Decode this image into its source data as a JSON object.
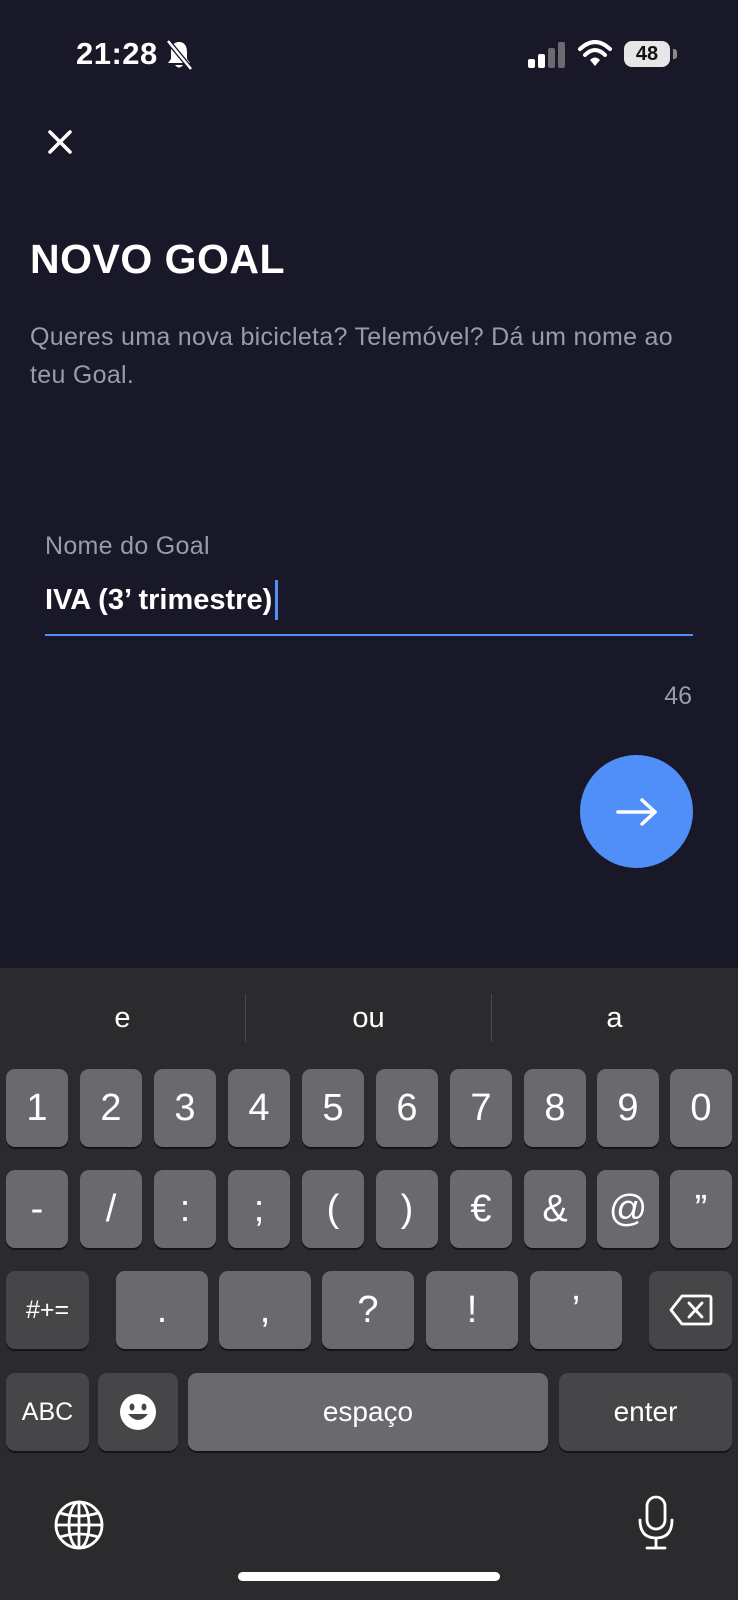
{
  "status_bar": {
    "time": "21:28",
    "battery": "48",
    "icons": [
      "bell-slash-icon",
      "cellular-signal-icon",
      "wifi-icon",
      "battery-icon"
    ]
  },
  "header": {
    "close_icon": "close-icon"
  },
  "content": {
    "title": "NOVO GOAL",
    "subtitle": "Queres uma nova bicicleta? Telemóvel? Dá um nome ao teu Goal.",
    "field": {
      "label": "Nome do Goal",
      "value": "IVA (3’ trimestre)"
    },
    "char_count": "46",
    "next_icon": "arrow-right-icon"
  },
  "colors": {
    "background": "#181828",
    "accent": "#4f8ff7",
    "muted_text": "#9a9ba6",
    "keyboard_bg": "#2b2b2e",
    "key_bg": "#6a6a6e",
    "key_dark_bg": "#464649"
  },
  "keyboard": {
    "suggestions": [
      "e",
      "ou",
      "a"
    ],
    "row1": [
      "1",
      "2",
      "3",
      "4",
      "5",
      "6",
      "7",
      "8",
      "9",
      "0"
    ],
    "row2": [
      "-",
      "/",
      ":",
      ";",
      "(",
      ")",
      "€",
      "&",
      "@",
      "”"
    ],
    "row3": {
      "shift": "#+=",
      "keys": [
        ".",
        ",",
        "?",
        "!",
        "’"
      ],
      "delete_icon": "backspace-icon"
    },
    "row4": {
      "abc": "ABC",
      "emoji_icon": "emoji-icon",
      "space": "espaço",
      "enter": "enter"
    },
    "globe_icon": "globe-icon",
    "mic_icon": "microphone-icon"
  }
}
